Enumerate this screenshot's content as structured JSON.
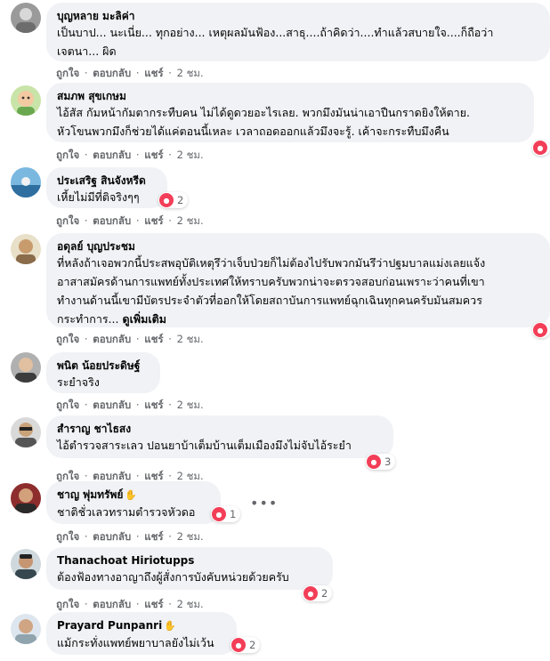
{
  "actions": {
    "like": "ถูกใจ",
    "reply": "ตอบกลับ",
    "share": "แชร์"
  },
  "more_icon": "ellipsis-icon",
  "comments": [
    {
      "author": "บุญหลาย มะลิค่า",
      "lines": [
        "เป็นบาป... นะเนี่ย... ทุกอย่าง... เหตุผลมันฟ้อง...สาธุ....ถ้าคิดว่า....ทำแล้วสบายใจ....ก็ถือว่า",
        "เจตนา... ผิด"
      ],
      "time": "2 ชม."
    },
    {
      "author": "สมภพ สุขเกษม",
      "lines": [
        "ไอ้สัส กัมหน้ากัมตากระทืบคน ไม่ได้ดูดวยอะไรเลย. พวกมึงมันน่าเอาปืนกราดยิงให้ตาย.",
        "หัวโขนพวกมึงก็ช่วยได้แค่ตอนนี้เหละ เวลาถอดออกแล้วมึงจะรู้. เค้าจะกระทืบมึงคืน"
      ],
      "time": "2 ชม.",
      "reaction": ""
    },
    {
      "author": "ประเสริฐ สินจังหรีด",
      "lines": [
        "เหี้ยไม่มีที่ติจริงๆๆ"
      ],
      "time": "2 ชม.",
      "reaction": "2"
    },
    {
      "author": "อดุลย์ บุญประชม",
      "lines": [
        "ที่หลังถ้าเจอพวกนี้ประสพอุบัติเหตุรึว่าเจ็บป่วยก็ไม่ต้องไปรับพวกมันรึว่าปฐมบาลแม่งเลยแจ้ง",
        "อาสาสมัครด้านการแพทย์ทั้งประเทศให้ทราบครับพวกน่าจะตรวจสอบก่อนเพราะว่าคนที่เขา",
        "ทำงานด้านนี้เขามีบัตรประจำตัวที่ออกให้โดยสถาบันการแพทย์ฉุกเฉินทุกคนครับมันสมควร",
        "กระทำการ..."
      ],
      "see_more": "ดูเพิ่มเติม",
      "time": "2 ชม.",
      "reaction": ""
    },
    {
      "author": "พนิต น้อยประดิษฐ์",
      "lines": [
        "ระยำจริง"
      ],
      "time": "2 ชม."
    },
    {
      "author": "สำราญ ชาไธสง",
      "lines": [
        "ไอ้ตำรวจสาระเลว ปอนยาบ้าเต็มบ้านเต็มเมืองมึงไม่จับไอ้ระยำ"
      ],
      "time": "2 ชม.",
      "reaction": "3"
    },
    {
      "author": "ชาญ พุ่มทรัพย์",
      "lines": [
        "ชาติชั่วเลวทรามตำรวจหัวดอ"
      ],
      "time": "2 ชม.",
      "reaction": "1"
    },
    {
      "author": "Thanachoat Hiriotupps",
      "lines": [
        "ต้องฟ้องทางอาญาถึงผู้สั่งการบังคับหน่วยด้วยครับ"
      ],
      "time": "2 ชม.",
      "reaction": "2"
    },
    {
      "author": "Prayard Punpanri",
      "lines": [
        "แม้กระทั่งแพทย์พยาบาลยังไม่เว้น"
      ],
      "reaction": "2"
    }
  ]
}
